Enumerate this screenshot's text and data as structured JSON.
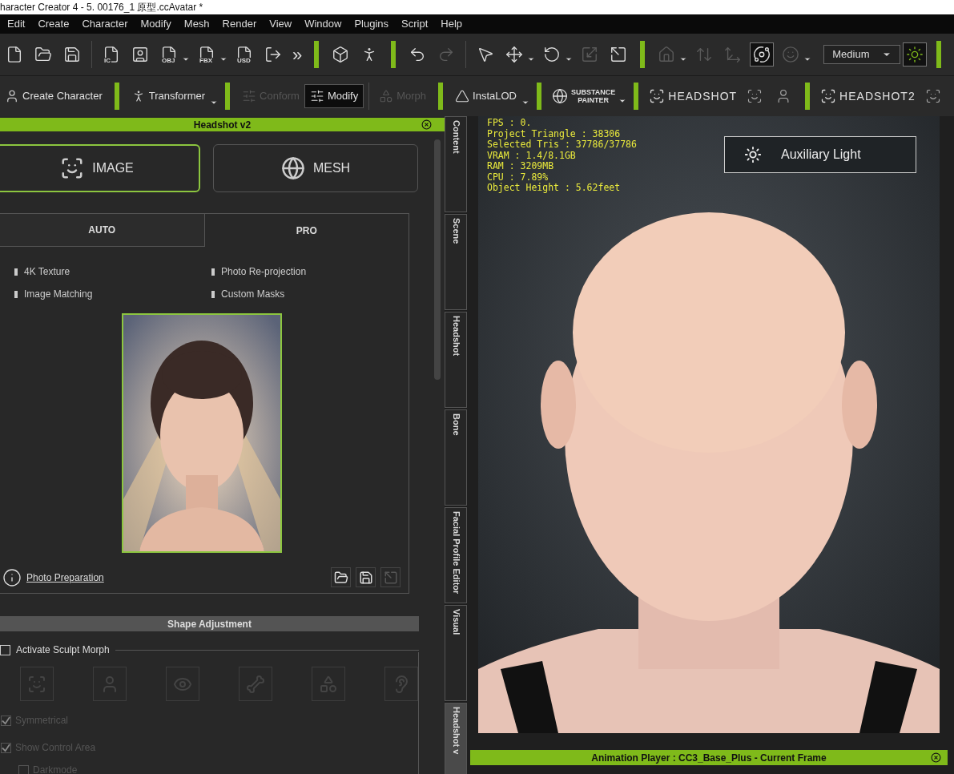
{
  "window": {
    "title": "haracter Creator 4 - 5. 00176_1 原型.ccAvatar *"
  },
  "menu": [
    "Edit",
    "Create",
    "Character",
    "Modify",
    "Mesh",
    "Render",
    "View",
    "Window",
    "Plugins",
    "Script",
    "Help"
  ],
  "toolbar": [
    {
      "kind": "icon",
      "dropdown": false,
      "disabled": false,
      "on": false
    },
    {
      "kind": "icon",
      "dropdown": false,
      "disabled": false,
      "on": false
    },
    {
      "kind": "icon",
      "dropdown": false,
      "disabled": false,
      "on": false
    },
    {
      "kind": "divider"
    },
    {
      "kind": "icon",
      "tag": "IC",
      "dropdown": false,
      "disabled": false,
      "on": false
    },
    {
      "kind": "icon",
      "dropdown": false,
      "disabled": false,
      "on": false
    },
    {
      "kind": "icon",
      "tag": "OBJ",
      "dropdown": true,
      "disabled": false,
      "on": false
    },
    {
      "kind": "icon",
      "tag": "FBX",
      "dropdown": true,
      "disabled": false,
      "on": false
    },
    {
      "kind": "icon",
      "tag": "USD",
      "dropdown": false,
      "disabled": false,
      "on": false
    },
    {
      "kind": "icon",
      "dropdown": false,
      "disabled": false,
      "on": false
    },
    {
      "kind": "more",
      "label": "»"
    },
    {
      "kind": "separator"
    },
    {
      "kind": "icon",
      "dropdown": false,
      "disabled": false,
      "on": false
    },
    {
      "kind": "icon",
      "dropdown": false,
      "disabled": false,
      "on": false
    },
    {
      "kind": "separator"
    },
    {
      "kind": "icon",
      "dropdown": false,
      "disabled": false,
      "on": false
    },
    {
      "kind": "icon",
      "dropdown": false,
      "disabled": true,
      "on": false
    },
    {
      "kind": "divider"
    },
    {
      "kind": "icon",
      "dropdown": false,
      "disabled": false,
      "on": false
    },
    {
      "kind": "icon",
      "dropdown": true,
      "disabled": false,
      "on": false
    },
    {
      "kind": "icon",
      "dropdown": true,
      "disabled": false,
      "on": false
    },
    {
      "kind": "icon",
      "dropdown": false,
      "disabled": true,
      "on": false
    },
    {
      "kind": "icon",
      "dropdown": false,
      "disabled": false,
      "on": false
    },
    {
      "kind": "separator"
    },
    {
      "kind": "icon",
      "dropdown": true,
      "disabled": true,
      "on": false
    },
    {
      "kind": "icon",
      "dropdown": false,
      "disabled": true,
      "on": false
    },
    {
      "kind": "icon",
      "dropdown": false,
      "disabled": true,
      "on": false
    },
    {
      "kind": "icon",
      "dropdown": false,
      "disabled": false,
      "on": true
    },
    {
      "kind": "icon",
      "dropdown": true,
      "disabled": true,
      "on": false
    },
    {
      "kind": "select",
      "value": "Medium"
    },
    {
      "kind": "icon",
      "dropdown": false,
      "disabled": false,
      "on": true
    },
    {
      "kind": "separator"
    }
  ],
  "plugin_bar": [
    {
      "kind": "tool",
      "label": "Create Character",
      "dropdown": false,
      "disabled": false,
      "selected": false
    },
    {
      "kind": "separator"
    },
    {
      "kind": "tool",
      "label": "Transformer",
      "dropdown": true,
      "disabled": false,
      "selected": false
    },
    {
      "kind": "separator"
    },
    {
      "kind": "tool",
      "label": "Conform",
      "dropdown": false,
      "disabled": true,
      "selected": false
    },
    {
      "kind": "tool",
      "label": "Modify",
      "dropdown": false,
      "disabled": false,
      "selected": true
    },
    {
      "kind": "divider"
    },
    {
      "kind": "tool",
      "label": "Morph",
      "dropdown": false,
      "disabled": true,
      "selected": false
    },
    {
      "kind": "separator"
    },
    {
      "kind": "tool",
      "label": "InstaLOD",
      "dropdown": true,
      "disabled": false,
      "selected": false
    },
    {
      "kind": "separator"
    },
    {
      "kind": "brand",
      "lines": [
        "SUBSTANCE",
        "PAINTER"
      ],
      "dropdown": true
    },
    {
      "kind": "separator"
    },
    {
      "kind": "brand",
      "lines": [
        "HEADSHOT"
      ],
      "dropdown": false
    },
    {
      "kind": "icon"
    },
    {
      "kind": "icon"
    },
    {
      "kind": "separator"
    },
    {
      "kind": "brand",
      "lines": [
        "HEADSHOT2"
      ],
      "dropdown": false
    },
    {
      "kind": "icon"
    }
  ],
  "panel": {
    "title": "Headshot v2",
    "modes": [
      {
        "label": "IMAGE",
        "selected": true
      },
      {
        "label": "MESH",
        "selected": false
      }
    ],
    "tabs": [
      {
        "label": "AUTO",
        "selected": false
      },
      {
        "label": "PRO",
        "selected": true
      }
    ],
    "features": [
      "4K Texture",
      "Photo Re-projection",
      "Image Matching",
      "Custom Masks"
    ],
    "link": "Photo Preparation",
    "file_buttons": [
      {
        "disabled": false
      },
      {
        "disabled": false
      },
      {
        "disabled": true
      }
    ],
    "section": "Shape Adjustment",
    "sculpt": {
      "label": "Activate Sculpt Morph",
      "checked": false
    },
    "sculpt_parts": [
      {
        "disabled": true
      },
      {
        "disabled": true
      },
      {
        "disabled": true
      },
      {
        "disabled": true
      },
      {
        "disabled": true
      },
      {
        "disabled": true
      }
    ],
    "options": [
      {
        "label": "Symmetrical",
        "checked": true,
        "disabled": true,
        "indented": false
      },
      {
        "label": "Show Control Area",
        "checked": true,
        "disabled": true,
        "indented": false
      },
      {
        "label": "Darkmode",
        "checked": false,
        "disabled": true,
        "indented": true
      }
    ]
  },
  "side_tabs": [
    {
      "label": "Content",
      "selected": false
    },
    {
      "label": "Scene",
      "selected": false
    },
    {
      "label": "Headshot",
      "selected": false
    },
    {
      "label": "Bone",
      "selected": false
    },
    {
      "label": "Facial Profile Editor",
      "selected": false
    },
    {
      "label": "Visual",
      "selected": false
    },
    {
      "label": "Headshot v",
      "selected": true
    }
  ],
  "viewport": {
    "stats": [
      "FPS : 0.",
      "Project Triangle : 38306",
      "Selected Tris : 37786/37786",
      "VRAM : 1.4/8.1GB",
      "RAM : 3209MB",
      "CPU : 7.89%",
      "Object Height : 5.62feet"
    ],
    "light_button": "Auxiliary Light"
  },
  "animation_player": {
    "title": "Animation Player : CC3_Base_Plus - Current Frame"
  }
}
